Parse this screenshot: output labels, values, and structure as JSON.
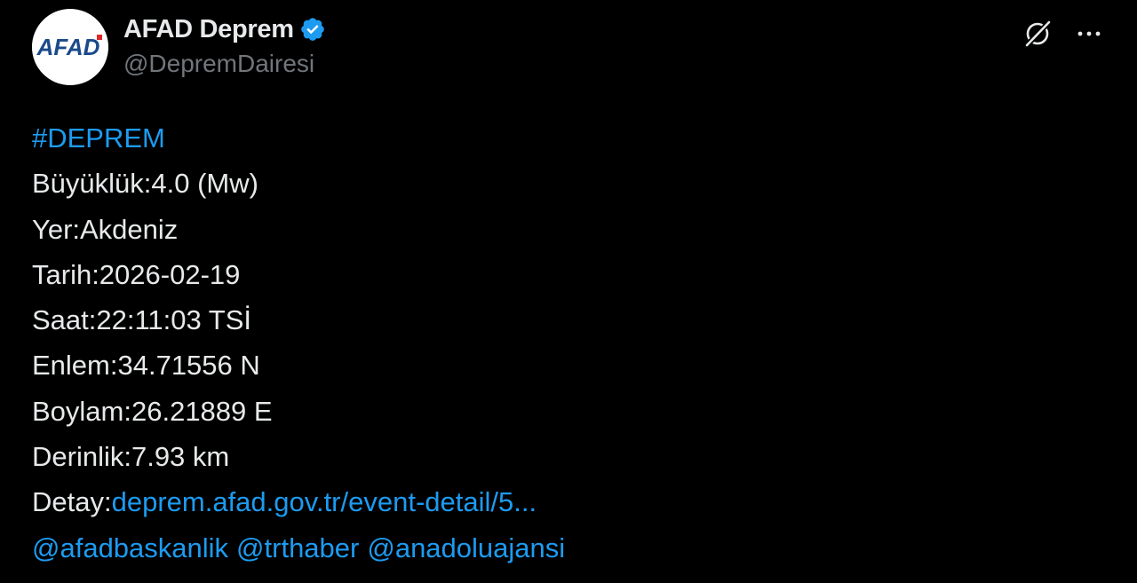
{
  "account": {
    "display_name": "AFAD Deprem",
    "handle": "@DepremDairesi",
    "avatar_text": "AFAD",
    "verified_icon": "verified-badge-icon"
  },
  "actions": {
    "grok_icon": "grok-icon",
    "more_icon": "more-options-icon"
  },
  "tweet": {
    "hashtag": "#DEPREM",
    "magnitude": "Büyüklük:4.0 (Mw)",
    "location": "Yer:Akdeniz",
    "date": "Tarih:2026-02-19",
    "time": "Saat:22:11:03 TSİ",
    "latitude": "Enlem:34.71556 N",
    "longitude": "Boylam:26.21889 E",
    "depth": "Derinlik:7.93 km",
    "detail_label": "Detay:",
    "detail_link": "deprem.afad.gov.tr/event-detail/5...",
    "mentions": [
      "@afadbaskanlik",
      "@trthaber",
      "@anadoluajansi"
    ]
  },
  "colors": {
    "background": "#000000",
    "text": "#e7e9ea",
    "muted": "#71767b",
    "link": "#1d9bf0",
    "verified": "#1d9bf0",
    "afad_blue": "#1a4a8a",
    "afad_red": "#e0262b"
  }
}
